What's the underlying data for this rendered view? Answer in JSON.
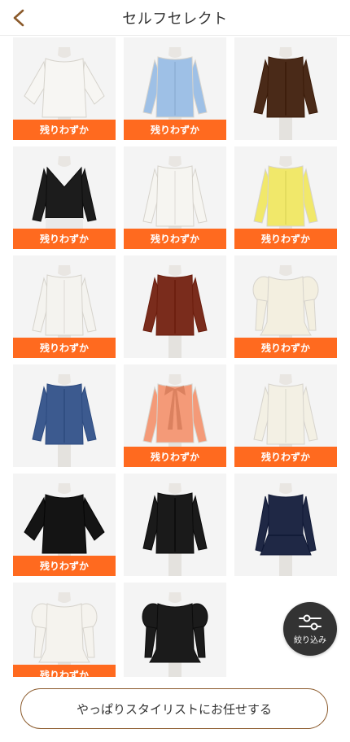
{
  "header": {
    "title": "セルフセレクト",
    "back_icon": "chevron-left-icon"
  },
  "colors": {
    "accent_brown": "#8b5a2b",
    "badge_orange": "#ff6a1f",
    "filter_bg": "#333333"
  },
  "items": [
    {
      "name": "white-wide-sleeve-blouse",
      "color": "#f7f6f3",
      "style": "wide",
      "badge": "残りわずか"
    },
    {
      "name": "blue-stripe-shirt",
      "color": "#9ec0e6",
      "style": "shirt",
      "badge": "残りわずか"
    },
    {
      "name": "brown-blouse",
      "color": "#4a2a18",
      "style": "blouse",
      "badge": ""
    },
    {
      "name": "black-cardigan",
      "color": "#1c1c1c",
      "style": "cardigan",
      "badge": "残りわずか"
    },
    {
      "name": "white-shirt",
      "color": "#f6f5f1",
      "style": "shirt",
      "badge": "残りわずか"
    },
    {
      "name": "yellow-shirt",
      "color": "#f1e86a",
      "style": "shirt",
      "badge": "残りわずか"
    },
    {
      "name": "white-gather-blouse",
      "color": "#f4f3ef",
      "style": "blouse",
      "badge": "残りわずか"
    },
    {
      "name": "brick-vneck-blouse",
      "color": "#7a2c1c",
      "style": "vneck",
      "badge": ""
    },
    {
      "name": "cream-puff-cardigan",
      "color": "#f3efe0",
      "style": "puff",
      "badge": "残りわずか"
    },
    {
      "name": "navy-drape-blouse",
      "color": "#3c5a8f",
      "style": "drape",
      "badge": ""
    },
    {
      "name": "salmon-bow-blouse",
      "color": "#f49a78",
      "style": "bow",
      "badge": "残りわずか"
    },
    {
      "name": "ivory-collar-shirt",
      "color": "#f3f0e4",
      "style": "shirt",
      "badge": "残りわずか"
    },
    {
      "name": "black-boatneck-blouse",
      "color": "#141414",
      "style": "wide",
      "badge": "残りわずか"
    },
    {
      "name": "black-bandcollar-shirt",
      "color": "#1a1a1a",
      "style": "shirt",
      "badge": ""
    },
    {
      "name": "navy-peplum-top",
      "color": "#1f2845",
      "style": "peplum",
      "badge": ""
    },
    {
      "name": "white-puff-peplum-top",
      "color": "#f5f3ee",
      "style": "puff",
      "badge": "残りわずか"
    },
    {
      "name": "black-lace-puff-top",
      "color": "#1b1b1b",
      "style": "puff",
      "badge": ""
    }
  ],
  "filter_button": {
    "label": "絞り込み",
    "icon": "sliders-icon"
  },
  "cta": {
    "label": "やっぱりスタイリストにお任せする"
  }
}
